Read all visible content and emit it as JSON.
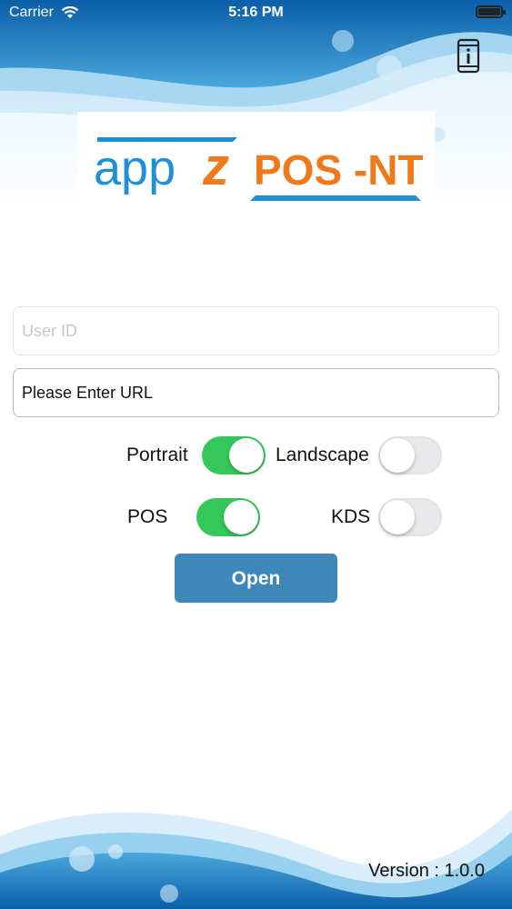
{
  "status_bar": {
    "carrier": "Carrier",
    "time": "5:16 PM"
  },
  "logo": {
    "part1": "app",
    "part2": "z",
    "part3": "POS -NT"
  },
  "form": {
    "user_id_placeholder": "User ID",
    "url_placeholder": "Please Enter URL"
  },
  "orientation": {
    "portrait_label": "Portrait",
    "portrait_on": true,
    "landscape_label": "Landscape",
    "landscape_on": false
  },
  "mode": {
    "pos_label": "POS",
    "pos_on": true,
    "kds_label": "KDS",
    "kds_on": false
  },
  "open_label": "Open",
  "version": "Version : 1.0.0",
  "colors": {
    "accent_green": "#34c759",
    "button_blue": "#3d88b8",
    "logo_blue": "#1f8fd6",
    "logo_orange": "#f07a1a"
  }
}
